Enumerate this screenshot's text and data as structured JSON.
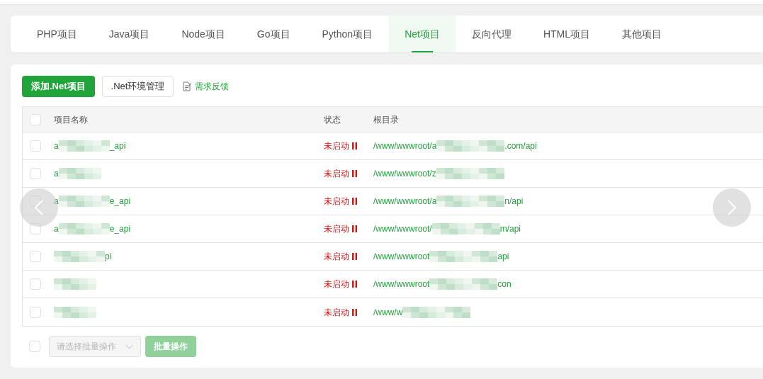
{
  "tabs": [
    {
      "label": "PHP项目",
      "selected": false
    },
    {
      "label": "Java项目",
      "selected": false
    },
    {
      "label": "Node项目",
      "selected": false
    },
    {
      "label": "Go项目",
      "selected": false
    },
    {
      "label": "Python项目",
      "selected": false
    },
    {
      "label": "Net项目",
      "selected": true
    },
    {
      "label": "反向代理",
      "selected": false
    },
    {
      "label": "HTML项目",
      "selected": false
    },
    {
      "label": "其他项目",
      "selected": false
    }
  ],
  "toolbar": {
    "add_button": "添加.Net项目",
    "env_button": ".Net环境管理",
    "feedback_link": "需求反馈"
  },
  "table": {
    "columns": [
      "项目名称",
      "状态",
      "根目录"
    ],
    "header_checked": false,
    "rows": [
      {
        "checked": false,
        "name_start": "a",
        "name_end": "_api",
        "status": "未启动",
        "root_start": "/www/wwwroot/a",
        "root_end": ".com/api"
      },
      {
        "checked": false,
        "name_start": "a",
        "name_end": "",
        "status": "未启动",
        "root_start": "/www/wwwroot/z",
        "root_end": ""
      },
      {
        "checked": false,
        "name_start": "a",
        "name_end": "e_api",
        "status": "未启动",
        "root_start": "/www/wwwroot/a",
        "root_end": "n/api"
      },
      {
        "checked": false,
        "name_start": "a",
        "name_end": "e_api",
        "status": "未启动",
        "root_start": "/www/wwwroot/",
        "root_end": "m/api"
      },
      {
        "checked": false,
        "name_start": "",
        "name_end": "pi",
        "status": "未启动",
        "root_start": "/www/wwwroot",
        "root_end": "api"
      },
      {
        "checked": false,
        "name_start": "",
        "name_end": "",
        "status": "未启动",
        "root_start": "/www/wwwroot",
        "root_end": "con"
      },
      {
        "checked": false,
        "name_start": "",
        "name_end": "",
        "status": "未启动",
        "root_start": "/www/w",
        "root_end": ""
      }
    ]
  },
  "footer": {
    "select_all_checked": false,
    "batch_select": {
      "placeholder": "请选择批量操作"
    },
    "batch_button": "批量操作"
  }
}
